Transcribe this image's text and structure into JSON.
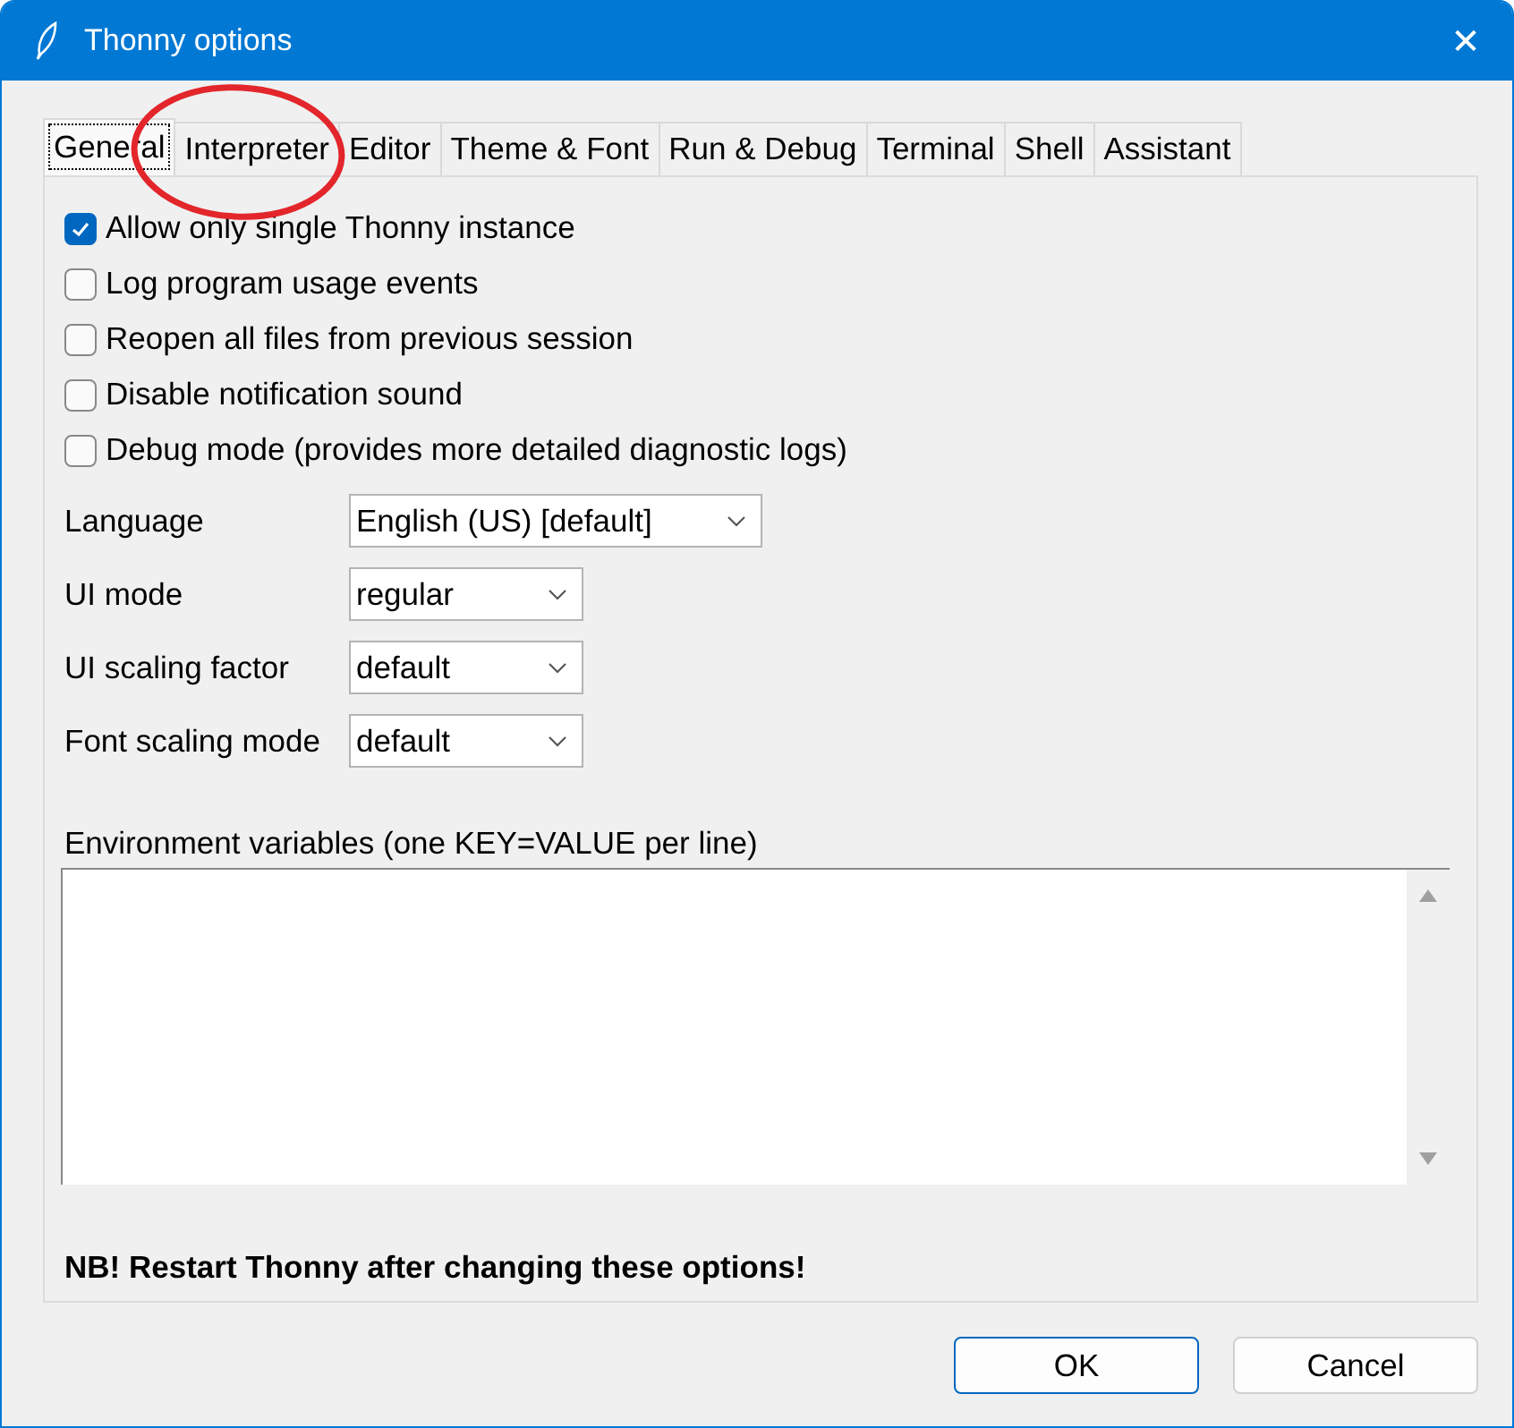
{
  "window": {
    "title": "Thonny options",
    "close": "✕"
  },
  "tabs": [
    {
      "label": "General",
      "selected": true
    },
    {
      "label": "Interpreter",
      "selected": false
    },
    {
      "label": "Editor",
      "selected": false
    },
    {
      "label": "Theme & Font",
      "selected": false
    },
    {
      "label": "Run & Debug",
      "selected": false
    },
    {
      "label": "Terminal",
      "selected": false
    },
    {
      "label": "Shell",
      "selected": false
    },
    {
      "label": "Assistant",
      "selected": false
    }
  ],
  "checkboxes": [
    {
      "label": "Allow only single Thonny instance",
      "checked": true
    },
    {
      "label": "Log program usage events",
      "checked": false
    },
    {
      "label": "Reopen all files from previous session",
      "checked": false
    },
    {
      "label": "Disable notification sound",
      "checked": false
    },
    {
      "label": "Debug mode (provides more detailed diagnostic logs)",
      "checked": false
    }
  ],
  "dropdowns": [
    {
      "label": "Language",
      "value": "English (US) [default]",
      "kind": "wide"
    },
    {
      "label": "UI mode",
      "value": "regular",
      "kind": "narrow"
    },
    {
      "label": "UI scaling factor",
      "value": "default",
      "kind": "narrow"
    },
    {
      "label": "Font scaling mode",
      "value": "default",
      "kind": "narrow"
    }
  ],
  "environment": {
    "label": "Environment variables (one KEY=VALUE per line)"
  },
  "note": "NB! Restart Thonny after changing these options!",
  "buttons": [
    {
      "label": "OK",
      "kind": "default"
    },
    {
      "label": "Cancel",
      "kind": "normal"
    }
  ],
  "annotations": [
    {
      "kind": "ellipse",
      "color": "#e3262b"
    }
  ]
}
